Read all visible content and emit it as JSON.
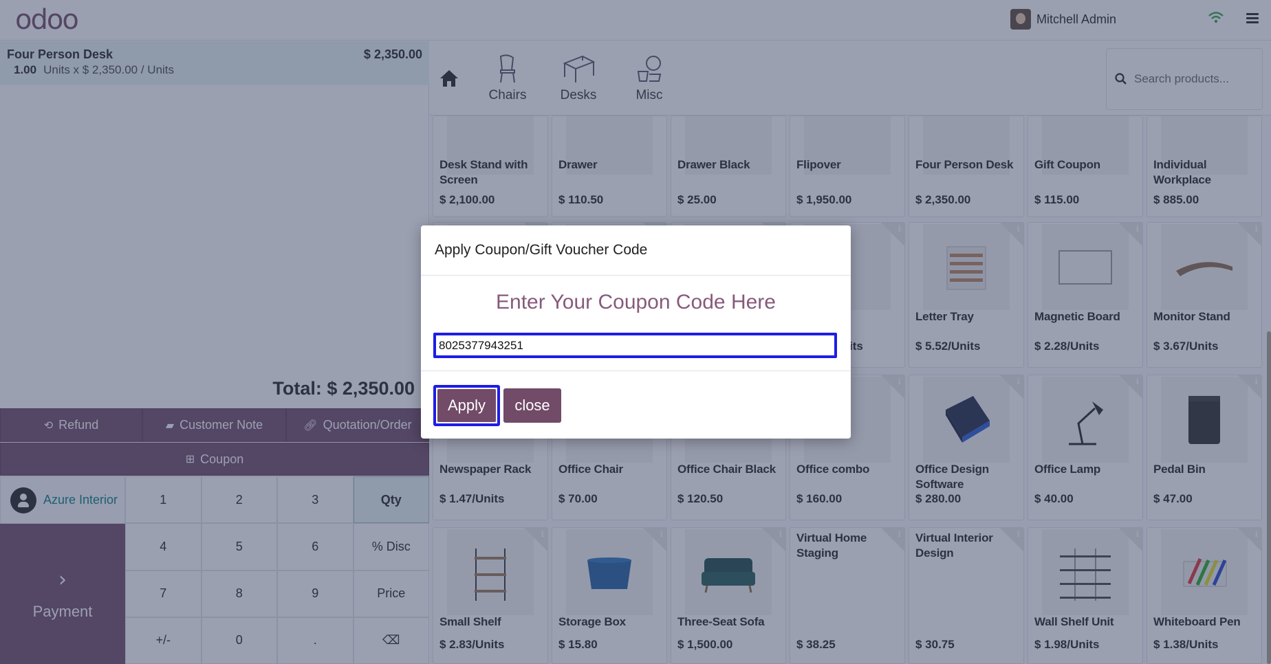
{
  "topbar": {
    "logo": "odoo",
    "user_name": "Mitchell Admin"
  },
  "order": {
    "line": {
      "name": "Four Person Desk",
      "price": "$ 2,350.00",
      "qty": "1.00",
      "detail": "Units x $ 2,350.00 / Units"
    },
    "total": "Total: $ 2,350.00"
  },
  "controls": {
    "refund": "Refund",
    "customer_note": "Customer Note",
    "quotation": "Quotation/Order",
    "coupon": "Coupon",
    "customer": "Azure Interior",
    "payment": "Payment"
  },
  "numpad": {
    "keys": [
      "1",
      "2",
      "3",
      "Qty",
      "4",
      "5",
      "6",
      "% Disc",
      "7",
      "8",
      "9",
      "Price",
      "+/-",
      "0",
      ".",
      "⌫"
    ],
    "active": "Qty"
  },
  "categories": {
    "items": [
      "Chairs",
      "Desks",
      "Misc"
    ]
  },
  "search": {
    "placeholder": "Search products..."
  },
  "products": [
    {
      "name": "Desk Stand with Screen",
      "price": "$ 2,100.00"
    },
    {
      "name": "Drawer",
      "price": "$ 110.50"
    },
    {
      "name": "Drawer Black",
      "price": "$ 25.00"
    },
    {
      "name": "Flipover",
      "price": "$ 1,950.00"
    },
    {
      "name": "Four Person Desk",
      "price": "$ 2,350.00"
    },
    {
      "name": "Gift Coupon",
      "price": "$ 115.00"
    },
    {
      "name": "Individual Workplace",
      "price": "$ 885.00"
    },
    {
      "name": "",
      "price": ""
    },
    {
      "name": "",
      "price": ""
    },
    {
      "name": "",
      "price": ""
    },
    {
      "name": "",
      "price": "its"
    },
    {
      "name": "Letter Tray",
      "price": "$ 5.52/Units"
    },
    {
      "name": "Magnetic Board",
      "price": "$ 2.28/Units"
    },
    {
      "name": "Monitor Stand",
      "price": "$ 3.67/Units"
    },
    {
      "name": "Newspaper Rack",
      "price": "$ 1.47/Units"
    },
    {
      "name": "Office Chair",
      "price": "$ 70.00"
    },
    {
      "name": "Office Chair Black",
      "price": "$ 120.50"
    },
    {
      "name": "Office combo",
      "price": "$ 160.00"
    },
    {
      "name": "Office Design Software",
      "price": "$ 280.00"
    },
    {
      "name": "Office Lamp",
      "price": "$ 40.00"
    },
    {
      "name": "Pedal Bin",
      "price": "$ 47.00"
    },
    {
      "name": "Small Shelf",
      "price": "$ 2.83/Units"
    },
    {
      "name": "Storage Box",
      "price": "$ 15.80"
    },
    {
      "name": "Three-Seat Sofa",
      "price": "$ 1,500.00"
    },
    {
      "name": "Virtual Home Staging",
      "price": "$ 38.25"
    },
    {
      "name": "Virtual Interior Design",
      "price": "$ 30.75"
    },
    {
      "name": "Wall Shelf Unit",
      "price": "$ 1.98/Units"
    },
    {
      "name": "Whiteboard Pen",
      "price": "$ 1.38/Units"
    }
  ],
  "modal": {
    "title": "Apply Coupon/Gift Voucher Code",
    "subtitle": "Enter Your Coupon Code Here",
    "code_value": "8025377943251",
    "apply_label": "Apply",
    "close_label": "close"
  },
  "colors": {
    "brand": "#714b67",
    "accent_teal": "#017e84",
    "focus_outline": "#1d1de6",
    "overlay": "rgba(55,65,100,0.5)"
  }
}
